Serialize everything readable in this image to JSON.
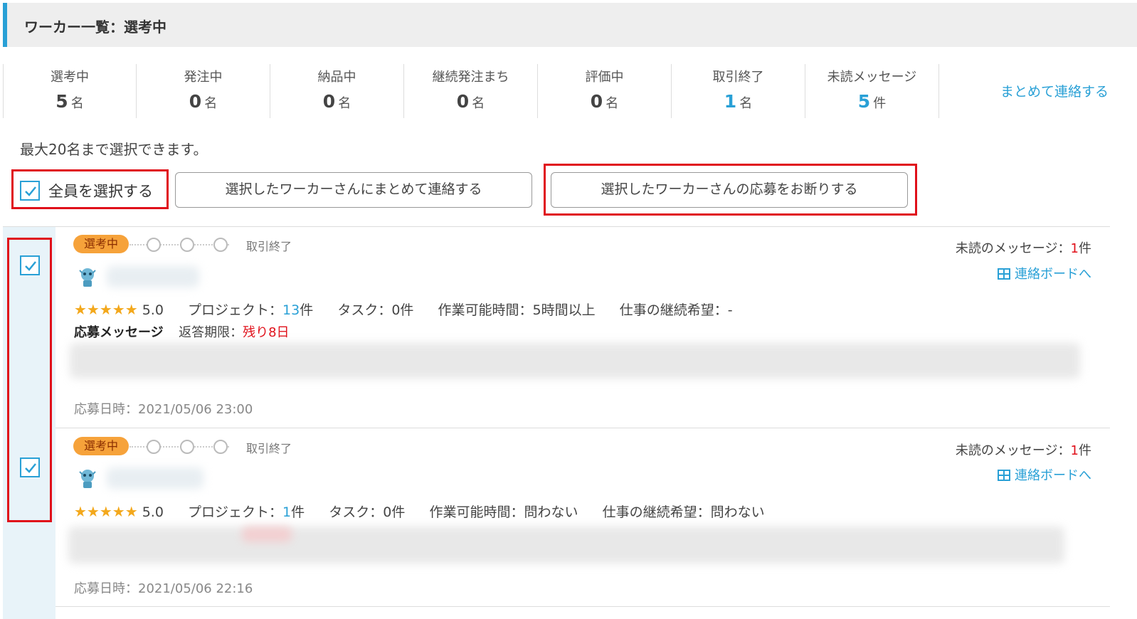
{
  "header": {
    "title": "ワーカー一覧：選考中"
  },
  "stats": [
    {
      "label": "選考中",
      "num": "5",
      "unit": "名",
      "highlight": false
    },
    {
      "label": "発注中",
      "num": "0",
      "unit": "名",
      "highlight": false
    },
    {
      "label": "納品中",
      "num": "0",
      "unit": "名",
      "highlight": false
    },
    {
      "label": "継続発注まち",
      "num": "0",
      "unit": "名",
      "highlight": false
    },
    {
      "label": "評価中",
      "num": "0",
      "unit": "名",
      "highlight": false
    },
    {
      "label": "取引終了",
      "num": "1",
      "unit": "名",
      "highlight": true
    },
    {
      "label": "未読メッセージ",
      "num": "5",
      "unit": "件",
      "highlight": true
    }
  ],
  "contact_all_link": "まとめて連絡する",
  "selection_note": "最大20名まで選択できます。",
  "select_all_label": "全員を選択する",
  "buttons": {
    "contact_selected": "選択したワーカーさんにまとめて連絡する",
    "decline_selected": "選択したワーカーさんの応募をお断りする"
  },
  "workers": [
    {
      "status_badge": "選考中",
      "step_end": "取引終了",
      "unread_prefix": "未読のメッセージ：",
      "unread_count": "1",
      "unread_suffix": "件",
      "board_link": "連絡ボードへ",
      "stars": "★★★★★",
      "rating": "5.0",
      "project_label": "プロジェクト：",
      "project_count": "13",
      "project_unit": "件",
      "task_label": "タスク：",
      "task_value": "0件",
      "hours_label": "作業可能時間：",
      "hours_value": "5時間以上",
      "continue_label": "仕事の継続希望：",
      "continue_value": "-",
      "message_title": "応募メッセージ",
      "deadline_label": "返答期限：",
      "deadline_value": "残り8日",
      "applied_at": "応募日時：2021/05/06 23:00",
      "checked": true
    },
    {
      "status_badge": "選考中",
      "step_end": "取引終了",
      "unread_prefix": "未読のメッセージ：",
      "unread_count": "1",
      "unread_suffix": "件",
      "board_link": "連絡ボードへ",
      "stars": "★★★★★",
      "rating": "5.0",
      "project_label": "プロジェクト：",
      "project_count": "1",
      "project_unit": "件",
      "task_label": "タスク：",
      "task_value": "0件",
      "hours_label": "作業可能時間：",
      "hours_value": "問わない",
      "continue_label": "仕事の継続希望：",
      "continue_value": "問わない",
      "applied_at": "応募日時：2021/05/06 22:16",
      "checked": true
    }
  ],
  "colors": {
    "accent": "#29a0d6",
    "badge": "#f6a23a",
    "highlight_red": "#e0101a"
  }
}
